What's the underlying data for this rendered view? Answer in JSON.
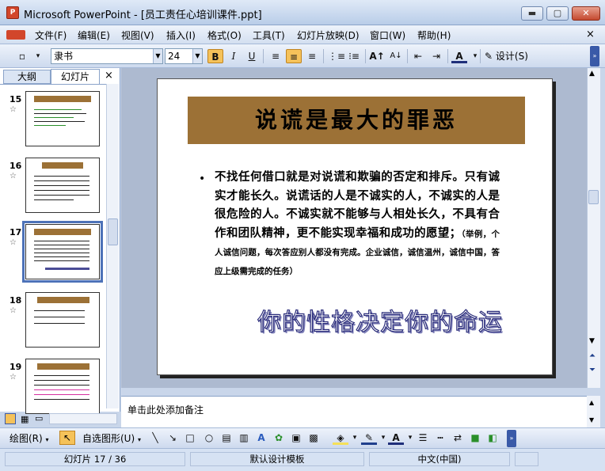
{
  "window": {
    "title": "Microsoft PowerPoint - [员工责任心培训课件.ppt]",
    "app_icon_text": "P",
    "buttons": {
      "minimize": "▬",
      "maximize": "▢",
      "close": "✕"
    }
  },
  "menu": {
    "items": [
      "文件(F)",
      "编辑(E)",
      "视图(V)",
      "插入(I)",
      "格式(O)",
      "工具(T)",
      "幻灯片放映(D)",
      "窗口(W)",
      "帮助(H)"
    ],
    "doc_close": "×"
  },
  "toolbar": {
    "font_name": "隶书",
    "font_size": "24",
    "bold": "B",
    "italic": "I",
    "underline": "U",
    "design_label": "设计(S)"
  },
  "left_pane": {
    "tabs": [
      "大纲",
      "幻灯片"
    ],
    "close": "×",
    "slides": [
      {
        "num": "15",
        "star": "☆"
      },
      {
        "num": "16",
        "star": "☆"
      },
      {
        "num": "17",
        "star": "☆"
      },
      {
        "num": "18",
        "star": "☆"
      },
      {
        "num": "19",
        "star": "☆"
      }
    ]
  },
  "slide": {
    "title": "说谎是最大的罪恶",
    "bullet": "•",
    "body": "不找任何借口就是对说谎和欺骗的否定和排斥。只有诚实才能长久。说谎话的人是不诚实的人，不诚实的人是很危险的人。不诚实就不能够与人相处长久，不具有合作和团队精神，更不能实现幸福和成功的愿望；",
    "example": "（举例，个人诚信问题，每次答应别人都没有完成。企业诚信，诚信温州，诚信中国，答应上级需完成的任务）",
    "wordart": "你的性格决定你的命运"
  },
  "notes": {
    "placeholder": "单击此处添加备注"
  },
  "drawbar": {
    "draw_label": "绘图(R)",
    "autoshape_label": "自选图形(U)"
  },
  "status": {
    "slide_info": "幻灯片 17 / 36",
    "template": "默认设计模板",
    "language": "中文(中国)"
  }
}
